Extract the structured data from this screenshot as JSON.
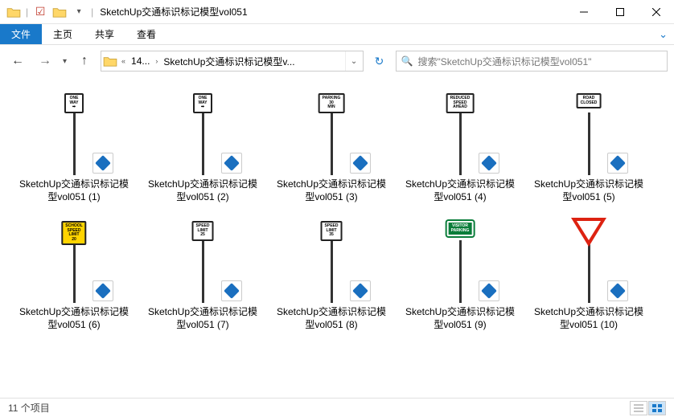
{
  "window": {
    "title": "SketchUp交通标识标记模型vol051"
  },
  "ribbon": {
    "file": "文件",
    "home": "主页",
    "share": "共享",
    "view": "查看"
  },
  "breadcrumb": {
    "seg1": "14...",
    "seg2": "SketchUp交通标识标记模型v..."
  },
  "search": {
    "placeholder": "搜索\"SketchUp交通标识标记模型vol051\""
  },
  "items": [
    {
      "label": "SketchUp交通标识标记模型vol051 (1)",
      "sign": "ONE\nWAY\n➡",
      "cls": ""
    },
    {
      "label": "SketchUp交通标识标记模型vol051 (2)",
      "sign": "ONE\nWAY\n➡",
      "cls": ""
    },
    {
      "label": "SketchUp交通标识标记模型vol051 (3)",
      "sign": "PARKING\n30\nMIN",
      "cls": ""
    },
    {
      "label": "SketchUp交通标识标记模型vol051 (4)",
      "sign": "REDUCED\nSPEED\nAHEAD",
      "cls": ""
    },
    {
      "label": "SketchUp交通标识标记模型vol051 (5)",
      "sign": "ROAD\nCLOSED",
      "cls": ""
    },
    {
      "label": "SketchUp交通标识标记模型vol051 (6)",
      "sign": "SCHOOL\nSPEED\nLIMIT\n20",
      "cls": "yellow"
    },
    {
      "label": "SketchUp交通标识标记模型vol051 (7)",
      "sign": "SPEED\nLIMIT\n25",
      "cls": ""
    },
    {
      "label": "SketchUp交通标识标记模型vol051 (8)",
      "sign": "SPEED\nLIMIT\n35",
      "cls": ""
    },
    {
      "label": "SketchUp交通标识标记模型vol051 (9)",
      "sign": "VISITOR\nPARKING",
      "cls": "green"
    },
    {
      "label": "SketchUp交通标识标记模型vol051 (10)",
      "sign": "",
      "cls": "yield"
    }
  ],
  "status": {
    "count": "11 个项目"
  }
}
